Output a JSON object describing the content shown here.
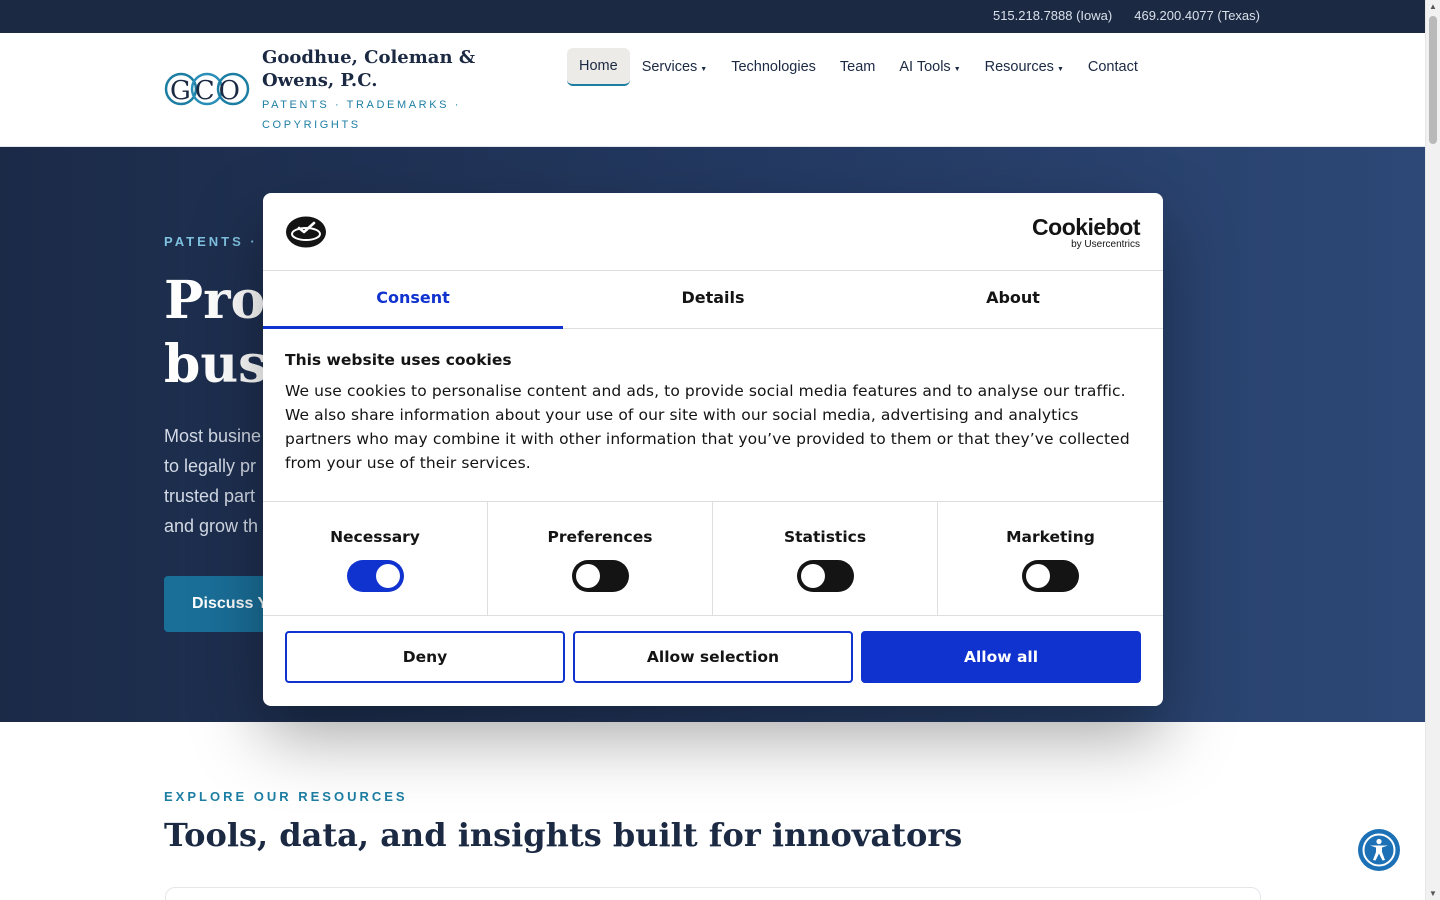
{
  "topbar": {
    "phone_iowa": "515.218.7888 (Iowa)",
    "phone_texas": "469.200.4077 (Texas)"
  },
  "header": {
    "logo_letters": "GCO",
    "brand_name": "Goodhue, Coleman & Owens, P.C.",
    "brand_tagline": "PATENTS · TRADEMARKS · COPYRIGHTS",
    "nav": {
      "home": "Home",
      "services": "Services",
      "technologies": "Technologies",
      "team": "Team",
      "ai_tools": "AI Tools",
      "resources": "Resources",
      "contact": "Contact"
    }
  },
  "hero": {
    "eyebrow": "PATENTS ·",
    "title_line1": "Prot",
    "title_line2": "busi",
    "text_lines": [
      "Most busine",
      "to legally pr",
      "trusted part",
      "and grow th"
    ],
    "cta_label": "Discuss Y"
  },
  "resources": {
    "eyebrow": "EXPLORE OUR RESOURCES",
    "title": "Tools, data, and insights built for innovators"
  },
  "cookie_dialog": {
    "brand": "Cookiebot",
    "brand_sub": "by Usercentrics",
    "tabs": {
      "consent": "Consent",
      "details": "Details",
      "about": "About"
    },
    "title": "This website uses cookies",
    "body": "We use cookies to personalise content and ads, to provide social media features and to analyse our traffic. We also share information about your use of our site with our social media, advertising and analytics partners who may combine it with other information that you’ve provided to them or that they’ve collected from your use of their services.",
    "toggles": {
      "necessary": {
        "label": "Necessary",
        "enabled": true
      },
      "preferences": {
        "label": "Preferences",
        "enabled": false
      },
      "statistics": {
        "label": "Statistics",
        "enabled": false
      },
      "marketing": {
        "label": "Marketing",
        "enabled": false
      }
    },
    "buttons": {
      "deny": "Deny",
      "allow_selection": "Allow selection",
      "allow_all": "Allow all"
    }
  },
  "colors": {
    "navy": "#1b2943",
    "accent_teal": "#1d7ea3",
    "cookiebot_blue": "#1032cf"
  },
  "icons": {
    "accessibility": "accessibility-icon"
  }
}
